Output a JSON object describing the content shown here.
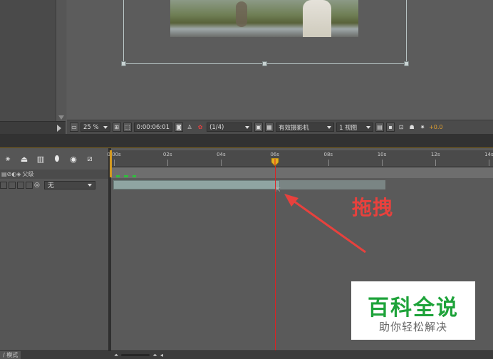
{
  "viewer": {
    "zoom": "25 %",
    "timecode": "0:00:06:01",
    "resolution": "(1/4)",
    "camera": "有效摄影机",
    "views": "1 视图",
    "exposure": "+0.0"
  },
  "timeline": {
    "ruler_labels": [
      "0:00s",
      "02s",
      "04s",
      "06s",
      "08s",
      "10s",
      "12s",
      "14s"
    ],
    "header_parent_label": "父级",
    "parent_value": "无",
    "current_time_seconds": 6.02,
    "layer_out_seconds": 6.0,
    "layer_extension_end_seconds": 10.1
  },
  "annotation": {
    "drag_label": "拖拽",
    "color": "#e8413d"
  },
  "bottom_bar": {
    "mode_label": "/ 模式"
  },
  "watermark": {
    "title": "百科全说",
    "subtitle": "助你轻松解决"
  },
  "icons": {
    "snapshot": "camera-icon",
    "channel": "rgb-icon",
    "graph": "graph-editor-icon",
    "render": "fast-preview-icon"
  }
}
